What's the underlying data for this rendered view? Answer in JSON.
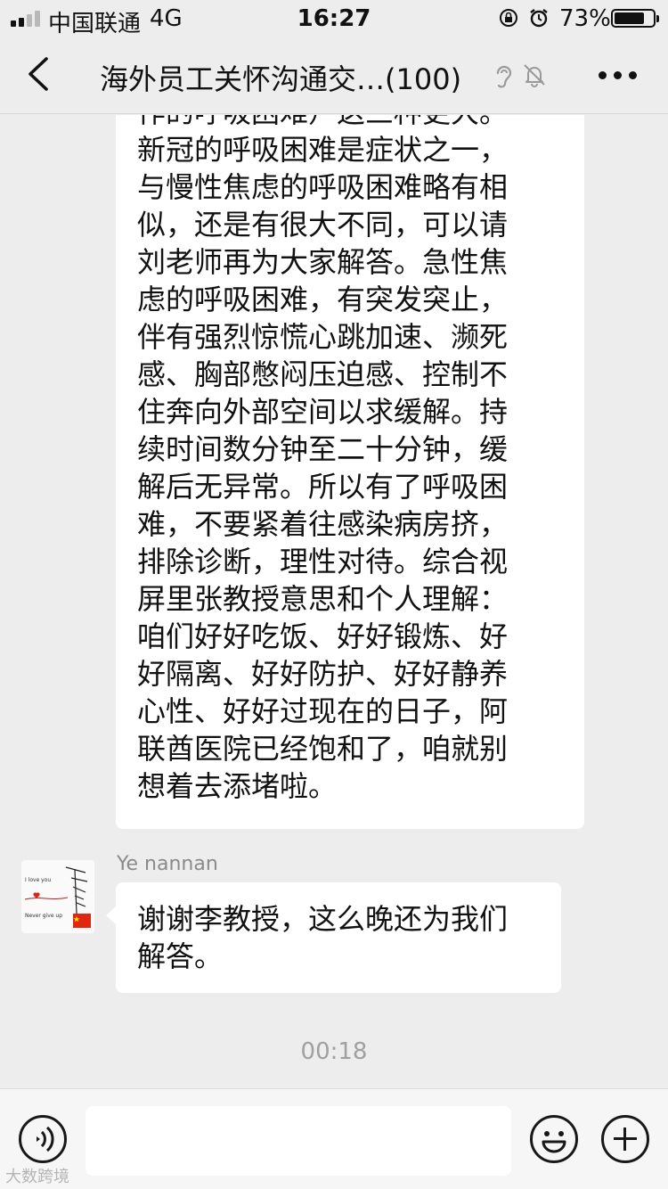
{
  "status_bar": {
    "carrier": "中国联通",
    "network": "4G",
    "time": "16:27",
    "battery_percent": "73%",
    "signal_bars_active": 2,
    "signal_bars_total": 4,
    "icons": [
      "signal-icon",
      "orientation-lock-icon",
      "alarm-icon",
      "battery-icon"
    ]
  },
  "nav": {
    "title": "海外员工关怀沟通交…(100)",
    "icons": [
      "back-arrow-icon",
      "earpiece-icon",
      "mute-bell-icon",
      "more-icon"
    ]
  },
  "messages": [
    {
      "text": "作的呼吸困难）这三种更大。\n新冠的呼吸困难是症状之一，\n与慢性焦虑的呼吸困难略有相\n似，还是有很大不同，可以请\n刘老师再为大家解答。急性焦\n虑的呼吸困难，有突发突止，\n伴有强烈惊慌心跳加速、濒死\n感、胸部憋闷压迫感、控制不\n住奔向外部空间以求缓解。持\n续时间数分钟至二十分钟，缓\n解后无异常。所以有了呼吸困\n难，不要紧着往感染病房挤，\n排除诊断，理性对待。综合视\n屏里张教授意思和个人理解：\n咱们好好吃饭、好好锻炼、好\n好隔离、好好防护、好好静养\n心性、好好过现在的日子，阿\n联酋医院已经饱和了，咱就别\n想着去添堵啦。"
    },
    {
      "sender": "Ye nannan",
      "avatar_text_1": "I love you",
      "avatar_text_2": "Never give up",
      "text": "谢谢李教授，这么晚还为我们\n解答。"
    }
  ],
  "timestamp": "00:18",
  "input_bar": {
    "placeholder": "",
    "icons": [
      "voice-icon",
      "emoji-icon",
      "add-icon"
    ]
  },
  "watermark": "大数跨境",
  "colors": {
    "background": "#ededed",
    "bubble": "#ffffff",
    "text": "#111111",
    "muted": "#8a8a8a"
  }
}
